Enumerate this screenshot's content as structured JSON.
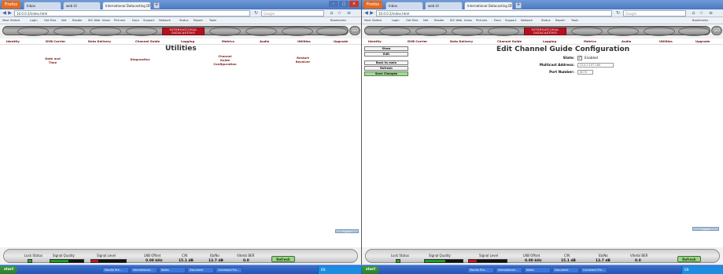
{
  "browser": {
    "firefox_label": "Firefox",
    "tabs_left": [
      "Inbox",
      "web UI",
      "International Datacasting DRS"
    ],
    "tabs_right": [
      "Inbox",
      "web UI",
      "International Datacasting DRS"
    ],
    "url_left": "10.0.0.2/index.html",
    "url_right": "10.0.0.2/index.html",
    "search_placeholder": "Google",
    "bookmarks": [
      "Most Visited",
      "Login",
      "Get Files",
      "Net",
      "Reader",
      "IDC Web",
      "Inbox",
      "Pictures",
      "Docs",
      "Support",
      "Network",
      "Status",
      "Report",
      "Tools",
      "Bookmarks"
    ]
  },
  "app": {
    "logo_line1": "INTERNATIONAL",
    "logo_line2": "DATACASTING",
    "go_button": "GO",
    "menu": [
      "Identity",
      "DVB Carrier",
      "Data Delivery",
      "Channel Guide",
      "Logging",
      "Metrics",
      "Audio",
      "Utilities",
      "Upgrade"
    ]
  },
  "left_page": {
    "title": "Utilities",
    "links": [
      "Date and\nTime",
      "Diagnostics",
      "Channel\nGuide\nConfiguration",
      "Restart\nReceiver"
    ],
    "corner_button": "Logout"
  },
  "right_page": {
    "title": "Edit Channel Guide Configuration",
    "side_buttons": [
      "Show",
      "Edit",
      "Back to main",
      "Refresh",
      "Save Changes"
    ],
    "state_label": "State:",
    "state_value": "Enabled",
    "state_checked": true,
    "multicast_label": "Multicast Address:",
    "multicast_value": "224.1.107.180",
    "port_label": "Port Number:",
    "port_value": "8070",
    "corner_button": "Logout"
  },
  "status": {
    "labels": [
      "Lock Status",
      "Signal Quality",
      "Signal Level",
      "LNB Offset",
      "C/N",
      "Eb/No",
      "Viterbi BER"
    ],
    "lnb_offset": "0.00 kHz",
    "cn_left": "15.1 dB",
    "cn_right": "15.1 dB",
    "ebno_left": "13.7 dB",
    "ebno_right": "13.7 dB",
    "viterbi_ber": "0.0",
    "refresh": "Refresh",
    "signal_quality_fraction": 0.55,
    "signal_level_fraction": 0.2,
    "colors": {
      "lock": "#2ea62e",
      "quality": "#1e9e28",
      "level": "#c0161c"
    }
  },
  "taskbar": {
    "start": "start",
    "tasks_left": [
      "Mozilla Fire...",
      "International...",
      "Notes",
      "Document",
      "Command Pro..."
    ],
    "tasks_right": [
      "Mozilla Fire...",
      "International...",
      "Notes",
      "Document",
      "Command Pro..."
    ],
    "tray": "EN"
  }
}
